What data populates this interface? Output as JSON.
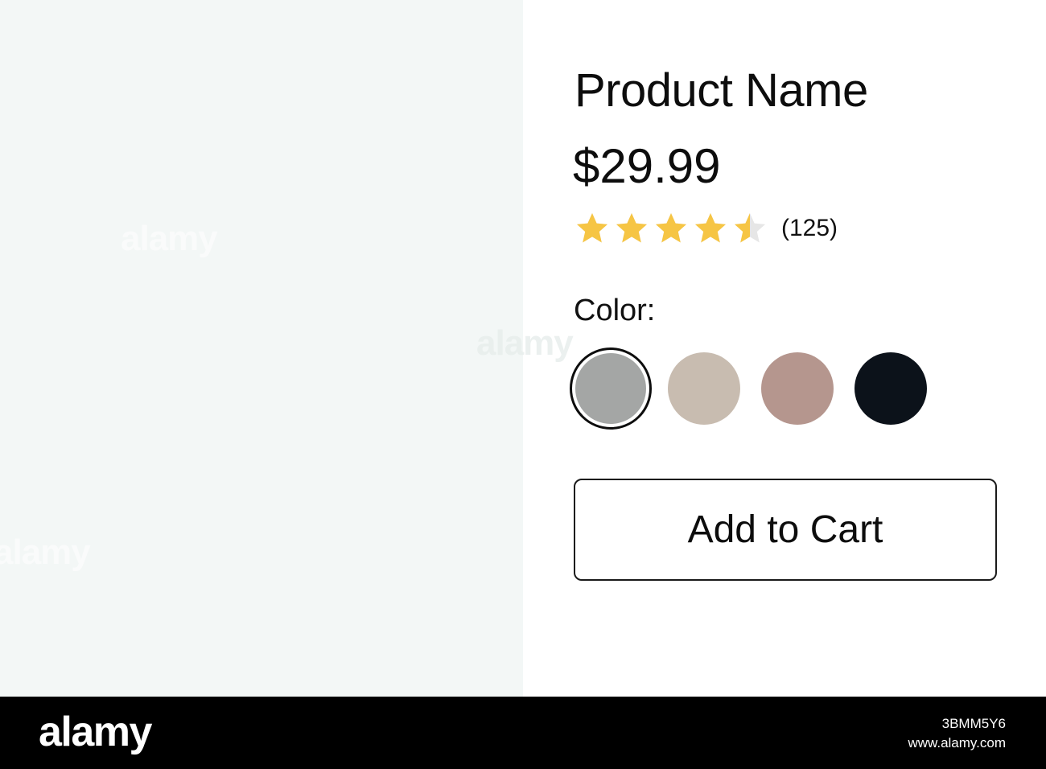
{
  "product": {
    "name": "Product Name",
    "price": "$29.99",
    "rating": {
      "value": 4.5,
      "max": 5,
      "count_label": "(125)",
      "filled_color": "#f6c544",
      "empty_color": "#e6e6e6"
    },
    "color_label": "Color:",
    "swatches": [
      {
        "color": "#a4a6a5",
        "selected": true
      },
      {
        "color": "#c8bcb0",
        "selected": false
      },
      {
        "color": "#b5968e",
        "selected": false
      },
      {
        "color": "#0c121a",
        "selected": false
      }
    ],
    "add_to_cart_label": "Add to Cart"
  },
  "watermark": {
    "text": "alamy",
    "image_id": "3BMM5Y6",
    "site": "www.alamy.com"
  }
}
